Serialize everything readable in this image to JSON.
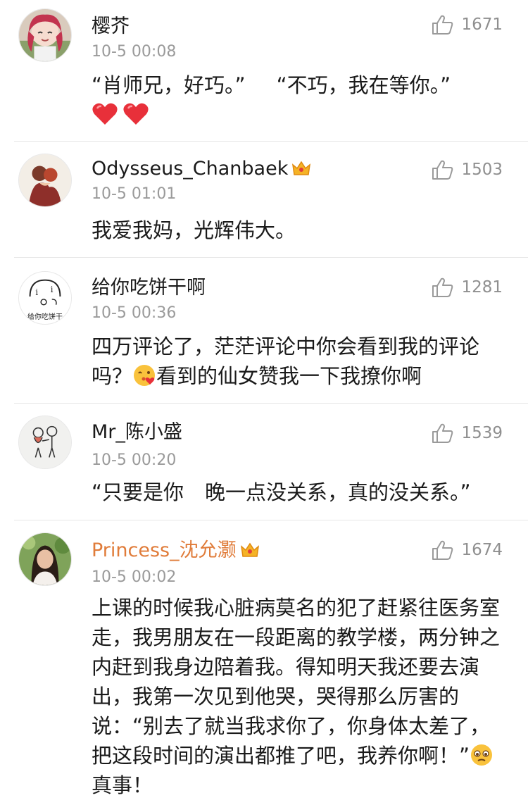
{
  "colors": {
    "vip_name": "#e07c3a",
    "time": "#9a9a9a",
    "like": "#8f8f8f",
    "divider": "#e6e6e6",
    "heart": "#e8303a"
  },
  "comments": [
    {
      "username": "樱芥",
      "time": "10-5 00:08",
      "likes": "1671",
      "text_a": "“肖师兄，好巧。”",
      "text_b": "“不巧，我在等你。”",
      "emojis": [
        "heart-emoji",
        "heart-emoji"
      ]
    },
    {
      "username": "Odysseus_Chanbaek",
      "vip_badge": "vip-crown-icon",
      "time": "10-5 01:01",
      "likes": "1503",
      "text": "我爱我妈，光辉伟大。"
    },
    {
      "username": "给你吃饼干啊",
      "avatar_caption": "给你吃饼干",
      "time": "10-5 00:36",
      "likes": "1281",
      "text_a": "四万评论了，茫茫评论中你会看到我的评论吗？",
      "emoji": "blowing-kiss-emoji",
      "text_b": "看到的仙女赞我一下我撩你啊"
    },
    {
      "username": "Mr_陈小盛",
      "time": "10-5 00:20",
      "likes": "1539",
      "text_a": "“只要是你",
      "text_b": "晚一点没关系，真的没关系。”"
    },
    {
      "username": "Princess_沈允灏",
      "vip_badge": "vip-crown-icon",
      "time": "10-5 00:02",
      "likes": "1674",
      "text_a": "上课的时候我心脏病莫名的犯了赶紧往医务室走，我男朋友在一段距离的教学楼，两分钟之内赶到我身边陪着我。得知明天我还要去演出，我第一次见到他哭，哭得那么厉害的说：“别去了就当我求你了，你身体太差了，把这段时间的演出都推了吧，我养你啊！”",
      "emoji": "teary-face-emoji",
      "text_b": "真事！"
    }
  ]
}
